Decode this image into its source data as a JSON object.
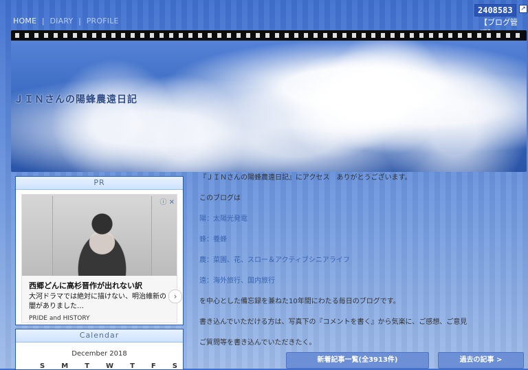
{
  "nav": {
    "items": [
      "HOME",
      "DIARY",
      "PROFILE"
    ],
    "separator": "|"
  },
  "header": {
    "counter": "2408583",
    "counter_icon": "external-link-icon",
    "admin_link": "【ブログ管理】"
  },
  "banner": {
    "title": "ＪＩＮさんの陽蜂農遠日記"
  },
  "sidebar": {
    "pr_title": "PR",
    "ad": {
      "choices_label": "ⓘ ✕",
      "headline": "西郷どんに高杉晋作が出れない訳",
      "description": "大河ドラマでは絶対に描けない、明治維新の闇がありました…",
      "source": "PRIDE and HISTORY",
      "next_icon": "chevron-right-icon"
    },
    "calendar_title": "Calendar",
    "calendar_month": "December 2018",
    "calendar_dow": [
      "S",
      "M",
      "T",
      "W",
      "T",
      "F",
      "S"
    ]
  },
  "main": {
    "lines": [
      "『ＪＩＮさんの陽蜂農遠日記』にアクセス　ありがとうございます。",
      "このブログは",
      "陽：太陽光発電",
      "蜂：養蜂",
      "農：菜園、花、スロー＆アクティブシニアライフ",
      "遠：海外旅行、国内旅行",
      "を中心とした備忘録を兼ねた10年間にわたる毎日のブログです。",
      "書き込んでいただける方は、写真下の『コメントを書く』から気楽に、ご感想、ご意見",
      "ご質問等を書き込んでいただきたく。"
    ]
  },
  "buttons": {
    "new_articles": "新着記事一覧(全3913件)",
    "past_articles": "過去の記事 >"
  }
}
